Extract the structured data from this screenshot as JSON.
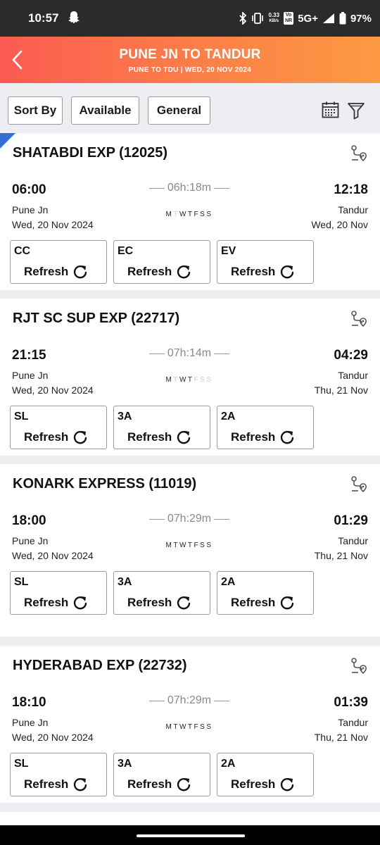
{
  "status_bar": {
    "time": "10:57",
    "speed_value": "0.33",
    "speed_unit": "KB/s",
    "volte_top": "Vo",
    "volte_bottom": "NR",
    "network": "5G+",
    "battery": "97%"
  },
  "header": {
    "title": "PUNE JN TO TANDUR",
    "subtitle": "PUNE TO TDU | WED, 20 NOV 2024"
  },
  "filters": {
    "sort_label": "Sort By",
    "available_label": "Available",
    "quota_label": "General"
  },
  "trains": [
    {
      "name": "SHATABDI EXP (12025)",
      "dep_time": "06:00",
      "arr_time": "12:18",
      "duration": "06h:18m",
      "from_station": "Pune Jn",
      "from_date": "Wed, 20 Nov  2024",
      "to_station": "Tandur",
      "to_date": "Wed, 20 Nov",
      "days": [
        {
          "d": "M",
          "on": true
        },
        {
          "d": "T",
          "on": false
        },
        {
          "d": "W",
          "on": true
        },
        {
          "d": "T",
          "on": true
        },
        {
          "d": "F",
          "on": true
        },
        {
          "d": "S",
          "on": true
        },
        {
          "d": "S",
          "on": true
        }
      ],
      "classes": [
        {
          "code": "CC",
          "action": "Refresh"
        },
        {
          "code": "EC",
          "action": "Refresh"
        },
        {
          "code": "EV",
          "action": "Refresh"
        }
      ]
    },
    {
      "name": "RJT SC SUP EXP (22717)",
      "dep_time": "21:15",
      "arr_time": "04:29",
      "duration": "07h:14m",
      "from_station": "Pune Jn",
      "from_date": "Wed, 20 Nov  2024",
      "to_station": "Tandur",
      "to_date": "Thu, 21 Nov",
      "days": [
        {
          "d": "M",
          "on": true
        },
        {
          "d": "T",
          "on": false
        },
        {
          "d": "W",
          "on": true
        },
        {
          "d": "T",
          "on": true
        },
        {
          "d": "F",
          "on": false
        },
        {
          "d": "S",
          "on": false
        },
        {
          "d": "S",
          "on": false
        }
      ],
      "classes": [
        {
          "code": "SL",
          "action": "Refresh"
        },
        {
          "code": "3A",
          "action": "Refresh"
        },
        {
          "code": "2A",
          "action": "Refresh"
        }
      ]
    },
    {
      "name": "KONARK EXPRESS (11019)",
      "dep_time": "18:00",
      "arr_time": "01:29",
      "duration": "07h:29m",
      "from_station": "Pune Jn",
      "from_date": "Wed, 20 Nov  2024",
      "to_station": "Tandur",
      "to_date": "Thu, 21 Nov",
      "days": [
        {
          "d": "M",
          "on": true
        },
        {
          "d": "T",
          "on": true
        },
        {
          "d": "W",
          "on": true
        },
        {
          "d": "T",
          "on": true
        },
        {
          "d": "F",
          "on": true
        },
        {
          "d": "S",
          "on": true
        },
        {
          "d": "S",
          "on": true
        }
      ],
      "classes": [
        {
          "code": "SL",
          "action": "Refresh"
        },
        {
          "code": "3A",
          "action": "Refresh"
        },
        {
          "code": "2A",
          "action": "Refresh"
        }
      ]
    },
    {
      "name": "HYDERABAD EXP (22732)",
      "dep_time": "18:10",
      "arr_time": "01:39",
      "duration": "07h:29m",
      "from_station": "Pune Jn",
      "from_date": "Wed, 20 Nov  2024",
      "to_station": "Tandur",
      "to_date": "Thu, 21 Nov",
      "days": [
        {
          "d": "M",
          "on": true
        },
        {
          "d": "T",
          "on": true
        },
        {
          "d": "W",
          "on": true
        },
        {
          "d": "T",
          "on": true
        },
        {
          "d": "F",
          "on": true
        },
        {
          "d": "S",
          "on": true
        },
        {
          "d": "S",
          "on": true
        }
      ],
      "classes": [
        {
          "code": "SL",
          "action": "Refresh"
        },
        {
          "code": "3A",
          "action": "Refresh"
        },
        {
          "code": "2A",
          "action": "Refresh"
        }
      ]
    }
  ],
  "colors": {
    "header_gradient_start": "#fb5b52",
    "header_gradient_end": "#fd9a42",
    "available_corner": "#2f6fd6"
  }
}
